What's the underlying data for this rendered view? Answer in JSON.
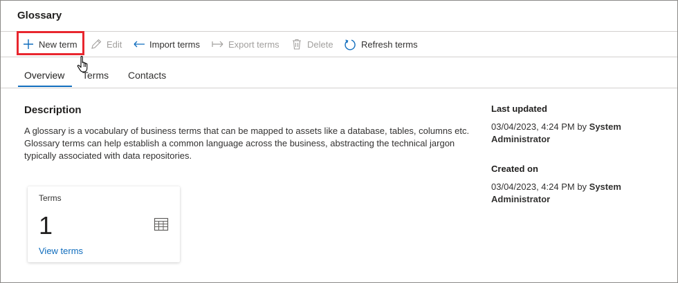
{
  "title": "Glossary",
  "toolbar": {
    "new_term": "New term",
    "edit": "Edit",
    "import_terms": "Import terms",
    "export_terms": "Export terms",
    "delete": "Delete",
    "refresh_terms": "Refresh terms"
  },
  "tabs": [
    {
      "label": "Overview",
      "active": true
    },
    {
      "label": "Terms",
      "active": false
    },
    {
      "label": "Contacts",
      "active": false
    }
  ],
  "description": {
    "heading": "Description",
    "text": "A glossary is a vocabulary of business terms that can be mapped to assets like a database, tables, columns etc. Glossary terms can help establish a common language across the business, abstracting the technical jargon typically associated with data repositories."
  },
  "terms_card": {
    "label": "Terms",
    "count": "1",
    "link": "View terms",
    "icon": "table-icon"
  },
  "last_updated": {
    "heading": "Last updated",
    "date": "03/04/2023, 4:24 PM by ",
    "user": "System Administrator"
  },
  "created_on": {
    "heading": "Created on",
    "date": "03/04/2023, 4:24 PM by ",
    "user": "System Administrator"
  },
  "colors": {
    "accent": "#0f6cbd",
    "highlight": "#e8262e",
    "disabled": "#a19f9d"
  }
}
